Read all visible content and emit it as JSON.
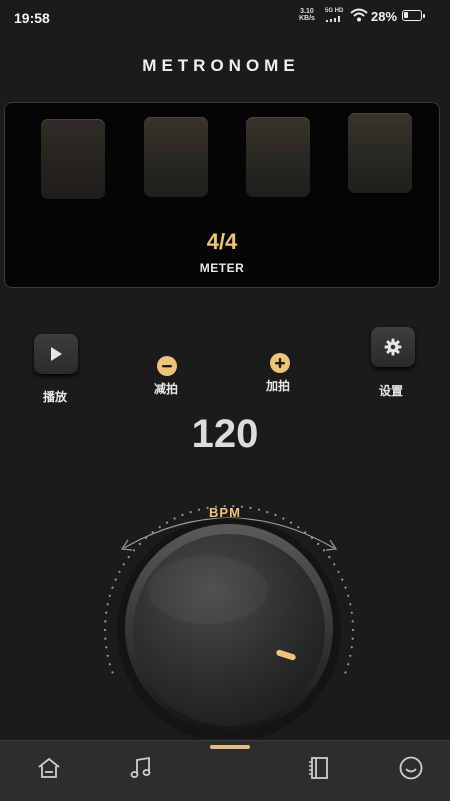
{
  "status_bar": {
    "time": "19:58",
    "net_speed_value": "3.10",
    "net_speed_unit": "KB/s",
    "network_type": "5G HD",
    "battery_percent": "28%",
    "battery_level": 0.28
  },
  "header": {
    "title": "METRONOME"
  },
  "meter": {
    "value": "4/4",
    "label": "METER",
    "beats": 4
  },
  "controls": {
    "play_label": "播放",
    "minus_label": "减拍",
    "plus_label": "加拍",
    "settings_label": "设置"
  },
  "tempo": {
    "bpm": "120",
    "bpm_label": "BPM"
  },
  "tabbar": {
    "icons": [
      "home-icon",
      "music-note-icon",
      "book-icon",
      "smile-icon"
    ]
  },
  "colors": {
    "accent": "#f0c37b",
    "background": "#1b1b1b",
    "panel": "#050505"
  }
}
